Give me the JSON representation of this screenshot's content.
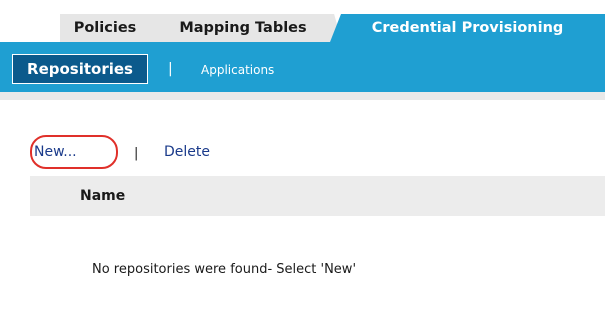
{
  "tabs": {
    "policies": "Policies",
    "mapping_tables": "Mapping Tables",
    "credential_provisioning": "Credential Provisioning"
  },
  "subnav": {
    "repositories": "Repositories",
    "separator": "|",
    "applications": "Applications"
  },
  "actions": {
    "new": "New...",
    "separator": "|",
    "delete": "Delete"
  },
  "table": {
    "columns": [
      "Name"
    ],
    "empty_message": "No repositories were found- Select 'New'"
  },
  "colors": {
    "accent": "#1f9fd2",
    "active_subtab": "#0b5a8c",
    "highlight_ring": "#e0302a",
    "link": "#1a3a8a"
  }
}
